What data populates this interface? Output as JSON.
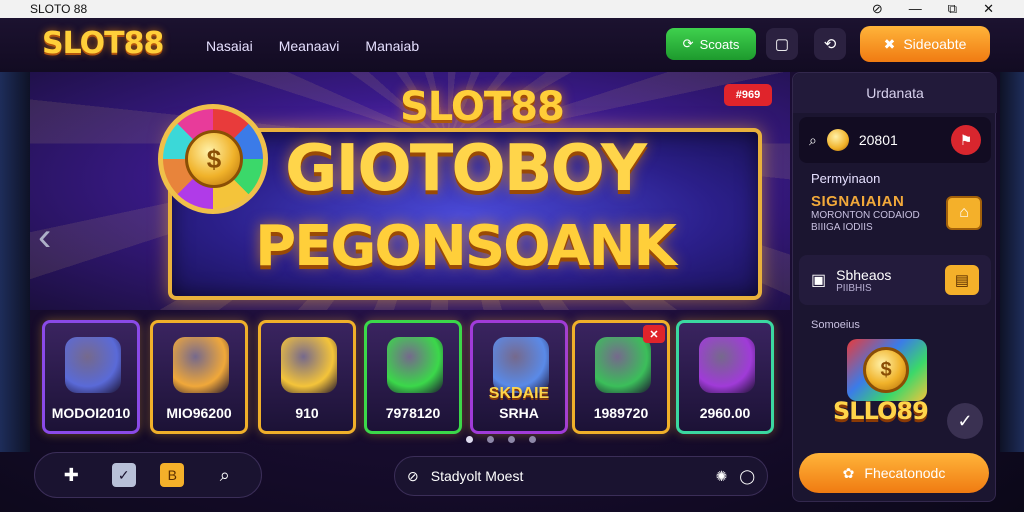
{
  "window": {
    "title": "SLOTO 88",
    "controls": [
      "⊘",
      "—",
      "⧉",
      "✕"
    ]
  },
  "header": {
    "logo": "SLOT88",
    "nav": [
      "Nasaiai",
      "Meanaavi",
      "Manaiab"
    ],
    "green_button": "Scoats",
    "orange_button": "Sideoabte"
  },
  "hero": {
    "brand": "SLOT88",
    "badge": "#969",
    "line1": "GIOTOBOY",
    "line2": "PEGONSOANK",
    "coin_symbol": "$"
  },
  "games": [
    {
      "label": "MODOI2010",
      "art_color": "#5a6ad8"
    },
    {
      "label": "MIO96200",
      "art_color": "#f0a83a"
    },
    {
      "label": "910",
      "art_color": "#f4c43a"
    },
    {
      "label": "7978120",
      "art_color": "#3bd84a"
    },
    {
      "label": "SKDAIE",
      "sub": "SRHA",
      "art_color": "#5a8ae8"
    },
    {
      "label": "1989720",
      "art_color": "#3bbf5a",
      "badge": "✕"
    },
    {
      "label": "2960.00",
      "art_color": "#a03bd8"
    }
  ],
  "carousel": {
    "count": 4,
    "active": 0
  },
  "bottom": {
    "mid_text": "Stadyolt Moest"
  },
  "right_panel": {
    "header": "Urdanata",
    "search_value": "20801",
    "section_title": "Permyinaon",
    "promo_title": "SIGNAIAIAN",
    "promo_line1": "MORONTON CODAIOD",
    "promo_line2": "BIIIGA IODIIS",
    "card_title": "Sbheaos",
    "card_sub": "PIIBHIS",
    "small_label": "Somoeius",
    "art_brand": "SLLO89",
    "cta": "Fhecatonodc"
  },
  "colors": {
    "accent_gold": "#ffcf3a",
    "green": "#2bb23e",
    "orange": "#f59020",
    "red": "#d8262e"
  }
}
